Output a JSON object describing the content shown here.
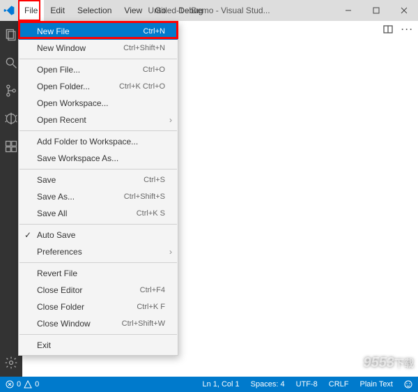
{
  "title": "Untitled-1 - Demo - Visual Stud...",
  "menubar": [
    "File",
    "Edit",
    "Selection",
    "View",
    "Go",
    "Debug"
  ],
  "file_menu": {
    "groups": [
      [
        {
          "label": "New File",
          "shortcut": "Ctrl+N",
          "selected": true
        },
        {
          "label": "New Window",
          "shortcut": "Ctrl+Shift+N"
        }
      ],
      [
        {
          "label": "Open File...",
          "shortcut": "Ctrl+O"
        },
        {
          "label": "Open Folder...",
          "shortcut": "Ctrl+K Ctrl+O"
        },
        {
          "label": "Open Workspace..."
        },
        {
          "label": "Open Recent",
          "submenu": true
        }
      ],
      [
        {
          "label": "Add Folder to Workspace..."
        },
        {
          "label": "Save Workspace As..."
        }
      ],
      [
        {
          "label": "Save",
          "shortcut": "Ctrl+S"
        },
        {
          "label": "Save As...",
          "shortcut": "Ctrl+Shift+S"
        },
        {
          "label": "Save All",
          "shortcut": "Ctrl+K S"
        }
      ],
      [
        {
          "label": "Auto Save",
          "checked": true
        },
        {
          "label": "Preferences",
          "submenu": true
        }
      ],
      [
        {
          "label": "Revert File"
        },
        {
          "label": "Close Editor",
          "shortcut": "Ctrl+F4"
        },
        {
          "label": "Close Folder",
          "shortcut": "Ctrl+K F"
        },
        {
          "label": "Close Window",
          "shortcut": "Ctrl+Shift+W"
        }
      ],
      [
        {
          "label": "Exit"
        }
      ]
    ]
  },
  "statusbar": {
    "errors": "0",
    "warnings": "0",
    "position": "Ln 1, Col 1",
    "spaces": "Spaces: 4",
    "encoding": "UTF-8",
    "eol": "CRLF",
    "language": "Plain Text"
  },
  "watermark": {
    "main": "9553",
    "suffix": "下载"
  }
}
